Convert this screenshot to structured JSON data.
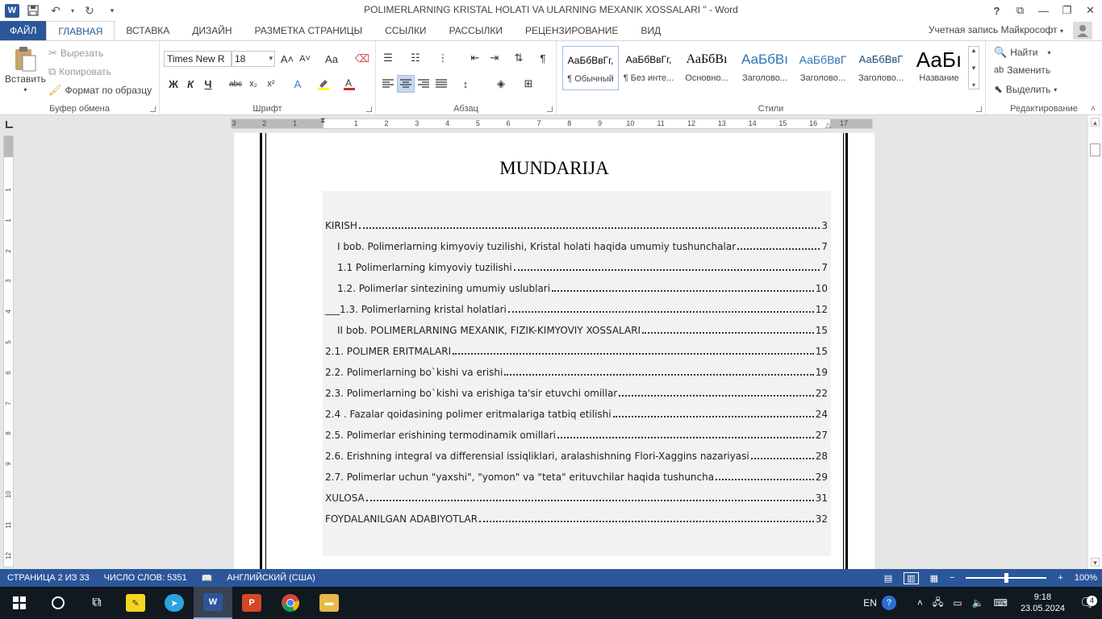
{
  "window": {
    "title": "POLIMERLARNING KRISTAL HOLATI VA ULARNING MEXANIK XOSSALARI \" - Word",
    "help": "?",
    "logo_letter": "W"
  },
  "tabs": [
    {
      "label": "ФАЙЛ"
    },
    {
      "label": "ГЛАВНАЯ"
    },
    {
      "label": "ВСТАВКА"
    },
    {
      "label": "ДИЗАЙН"
    },
    {
      "label": "РАЗМЕТКА СТРАНИЦЫ"
    },
    {
      "label": "ССЫЛКИ"
    },
    {
      "label": "РАССЫЛКИ"
    },
    {
      "label": "РЕЦЕНЗИРОВАНИЕ"
    },
    {
      "label": "ВИД"
    }
  ],
  "account": "Учетная запись Майкрософт",
  "ribbon": {
    "clipboard": {
      "label": "Буфер обмена",
      "paste": "Вставить",
      "cut": "Вырезать",
      "copy": "Копировать",
      "format_painter": "Формат по образцу"
    },
    "font": {
      "label": "Шрифт",
      "name": "Times New R",
      "size": "18",
      "bold": "Ж",
      "italic": "К",
      "underline": "Ч",
      "strike": "abc",
      "subscript": "x₂",
      "superscript": "x²",
      "grow": "A˄",
      "shrink": "A˅",
      "case": "Aa"
    },
    "paragraph": {
      "label": "Абзац"
    },
    "styles": {
      "label": "Стили",
      "items": [
        {
          "sample": "АаБбВвГг,",
          "name": "¶ Обычный"
        },
        {
          "sample": "АаБбВвГг,",
          "name": "¶ Без инте..."
        },
        {
          "sample": "АаБбВı",
          "name": "Основно..."
        },
        {
          "sample": "АаБбВı",
          "name": "Заголово..."
        },
        {
          "sample": "АаБбВвГ",
          "name": "Заголово..."
        },
        {
          "sample": "АаБбВвГ",
          "name": "Заголово..."
        },
        {
          "sample": "АаБı",
          "name": "Название"
        }
      ]
    },
    "editing": {
      "label": "Редактирование",
      "find": "Найти",
      "replace": "Заменить",
      "select": "Выделить"
    }
  },
  "ruler": {
    "h_numbers": [
      "3",
      "2",
      "1",
      "1",
      "2",
      "3",
      "4",
      "5",
      "6",
      "7",
      "8",
      "9",
      "10",
      "11",
      "12",
      "13",
      "14",
      "15",
      "16",
      "17"
    ],
    "v_numbers": [
      "1",
      "1",
      "2",
      "3",
      "4",
      "5",
      "6",
      "7",
      "8",
      "9",
      "10",
      "11",
      "12",
      "13"
    ]
  },
  "document": {
    "heading": "MUNDARIJA",
    "toc": [
      {
        "text": "KIRISH",
        "page": "3",
        "indent": 0
      },
      {
        "text": "I bob. Polimerlarning kimyoviy tuzilishi, Kristal holati haqida umumiy tushunchalar",
        "page": "7",
        "indent": 1
      },
      {
        "text": "1.1 Polimerlarning kimyoviy tuzilishi",
        "page": "7",
        "indent": 1
      },
      {
        "text": "1.2. Polimerlar sintezining umumiy uslublari",
        "page": "10",
        "indent": 1
      },
      {
        "text": "___1.3. Polimerlarning kristal holatlari",
        "page": "12",
        "indent": 0
      },
      {
        "text": "II bob.  POLIMERLARNING MEXANIK,  FIZIK-KIMYOVIY XOSSALARI",
        "page": "15",
        "indent": 1
      },
      {
        "text": "2.1. POLIMER ERITMALARI",
        "page": "15",
        "indent": 0
      },
      {
        "text": "2.2.  Polimerlarning bo`kishi va erishi",
        "page": "19",
        "indent": 0
      },
      {
        "text": "2.3. Polimerlarning bo`kishi va erishiga ta'sir etuvchi omillar",
        "page": "22",
        "indent": 0
      },
      {
        "text": "2.4 . Fazalar qoidasining polimer eritmalariga tatbiq etilishi",
        "page": "24",
        "indent": 0
      },
      {
        "text": "2.5. Polimerlar erishining termodinamik omillari",
        "page": "27",
        "indent": 0
      },
      {
        "text": "2.6. Erishning integral va differensial issiqliklari, aralashishning Flori-Xaggins nazariyasi",
        "page": "28",
        "indent": 0
      },
      {
        "text": "2.7. Polimerlar uchun \"yaxshi\", \"yomon\" va \"teta\" erituvchilar haqida tushuncha",
        "page": "29",
        "indent": 0
      },
      {
        "text": "XULOSA",
        "page": "31",
        "indent": 0
      },
      {
        "text": "FOYDALANILGAN ADABIYOTLAR",
        "page": "32",
        "indent": 0
      }
    ]
  },
  "status": {
    "page": "СТРАНИЦА 2 ИЗ 33",
    "words": "ЧИСЛО СЛОВ: 5351",
    "language": "АНГЛИЙСКИЙ (США)",
    "zoom": "100%",
    "zoom_minus": "−",
    "zoom_plus": "+",
    "zoom_fraction": 0.5
  },
  "taskbar": {
    "language": "EN",
    "time": "9:18",
    "date": "23.05.2024",
    "notifications": "4"
  }
}
